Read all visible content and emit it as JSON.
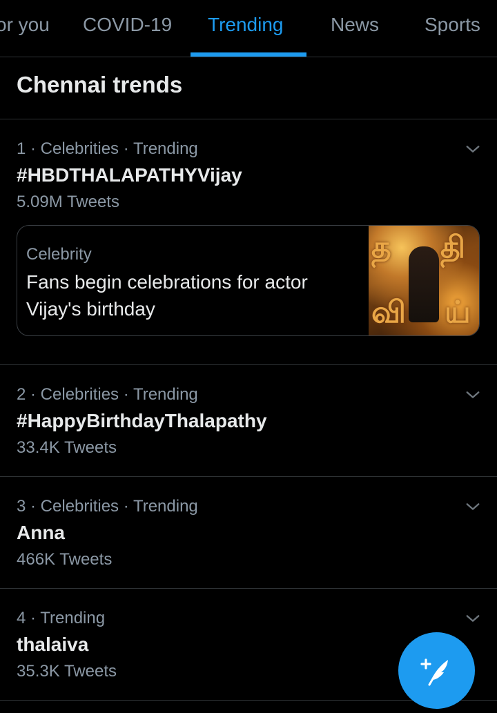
{
  "tabs": [
    {
      "label": "For you",
      "visible_text": "or you",
      "active": false
    },
    {
      "label": "COVID-19",
      "visible_text": "COVID-19",
      "active": false
    },
    {
      "label": "Trending",
      "visible_text": "Trending",
      "active": true
    },
    {
      "label": "News",
      "visible_text": "News",
      "active": false
    },
    {
      "label": "Sports",
      "visible_text": "Sports",
      "active": false
    }
  ],
  "section_title": "Chennai trends",
  "trends": [
    {
      "meta": "1 · Celebrities · Trending",
      "name": "#HBDTHALAPATHYVijay",
      "count": "5.09M Tweets",
      "card": {
        "category": "Celebrity",
        "headline": "Fans begin celebrations for actor Vijay's birthday",
        "image_text": "தளபதி விஜய்"
      }
    },
    {
      "meta": "2 · Celebrities · Trending",
      "name": "#HappyBirthdayThalapathy",
      "count": "33.4K Tweets"
    },
    {
      "meta": "3 · Celebrities · Trending",
      "name": "Anna",
      "count": "466K Tweets"
    },
    {
      "meta": "4 · Trending",
      "name": "thalaiva",
      "count": "35.3K Tweets"
    }
  ],
  "icons": {
    "more": "chevron-down-icon",
    "compose": "compose-tweet-icon"
  },
  "colors": {
    "background": "#000000",
    "accent": "#1d9bf0",
    "primary_text": "#e7e9ea",
    "secondary_text": "#8b98a5",
    "divider": "#2f3336"
  }
}
